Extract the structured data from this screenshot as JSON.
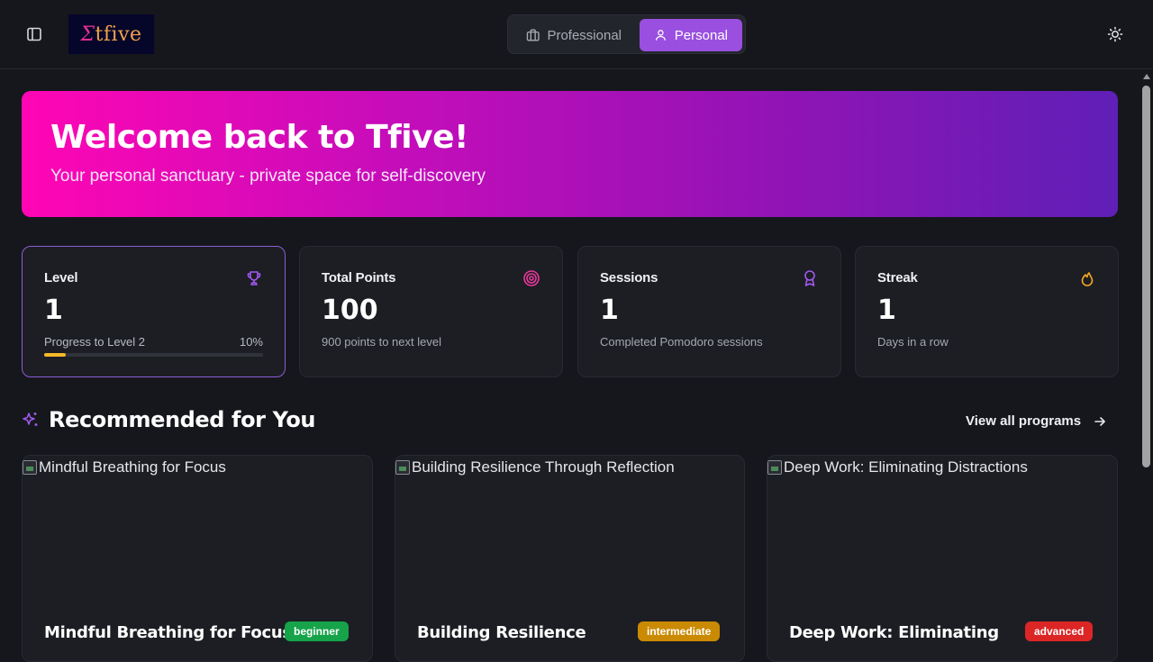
{
  "header": {
    "sidebar_toggle_icon": "panel-left-icon",
    "logo_text_a": "Σ",
    "logo_text_b": "tfive",
    "modes": [
      {
        "label": "Professional",
        "icon": "briefcase-icon",
        "selected": false
      },
      {
        "label": "Personal",
        "icon": "user-icon",
        "selected": true
      }
    ],
    "theme_icon": "sun-icon"
  },
  "hero": {
    "title": "Welcome back to Tfive!",
    "subtitle": "Your personal sanctuary - private space for self-discovery"
  },
  "stats": [
    {
      "label": "Level",
      "value": "1",
      "icon": "trophy-icon",
      "progress_label": "Progress to Level 2",
      "progress_text": "10%",
      "progress_fraction": 0.1
    },
    {
      "label": "Total Points",
      "value": "100",
      "icon": "target-icon",
      "sub": "900 points to next level"
    },
    {
      "label": "Sessions",
      "value": "1",
      "icon": "award-icon",
      "sub": "Completed Pomodoro sessions"
    },
    {
      "label": "Streak",
      "value": "1",
      "icon": "flame-icon",
      "sub": "Days in a row"
    }
  ],
  "recommended": {
    "title": "Recommended for You",
    "icon": "sparkles-icon",
    "view_all": "View all programs",
    "programs": [
      {
        "image_alt": "Mindful Breathing for Focus",
        "title": "Mindful Breathing for Focus",
        "level": "beginner",
        "color": "#16a34a"
      },
      {
        "image_alt": "Building Resilience Through Reflection",
        "title": "Building Resilience",
        "level": "intermediate",
        "color": "#ca8a04"
      },
      {
        "image_alt": "Deep Work: Eliminating Distractions",
        "title": "Deep Work: Eliminating",
        "level": "advanced",
        "color": "#dc2626"
      }
    ]
  },
  "colors": {
    "accent": "#9a4fe0",
    "hero_gradient": [
      "#ff06b4",
      "#5f1fb7"
    ],
    "progress": "#f5b828"
  }
}
